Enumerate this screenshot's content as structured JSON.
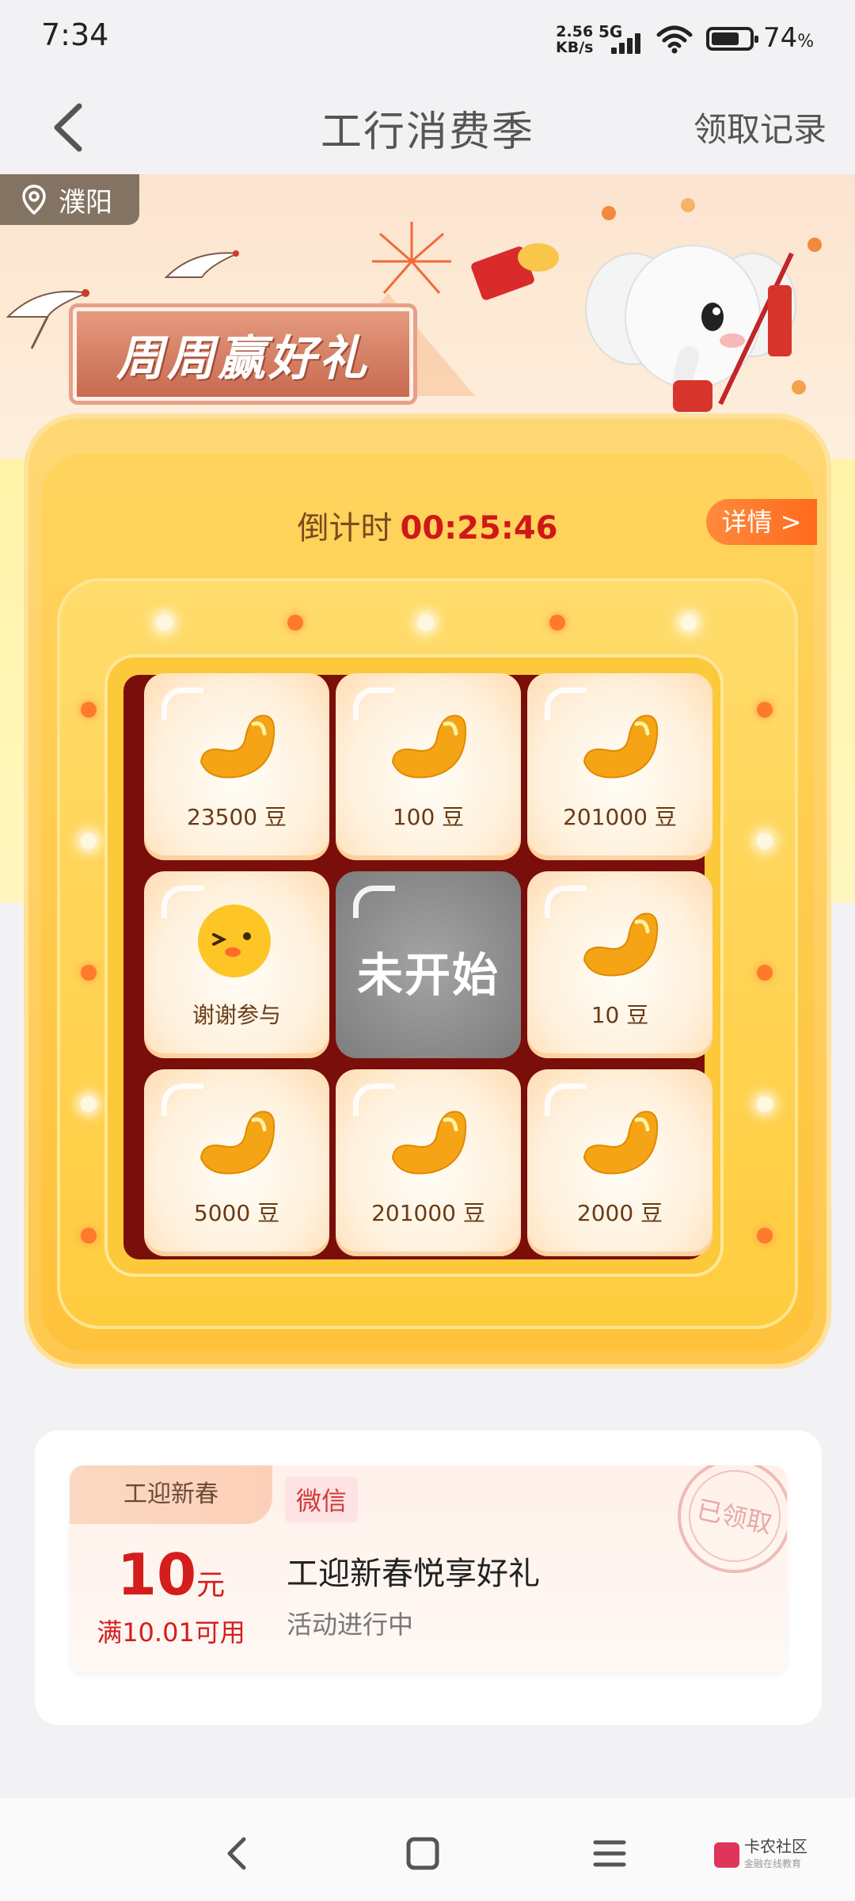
{
  "status_bar": {
    "time": "7:34",
    "speed_value": "2.56",
    "speed_unit": "KB/s",
    "network": "5G",
    "battery": "74",
    "battery_unit": "%"
  },
  "nav": {
    "title": "工行消费季",
    "record_link": "领取记录"
  },
  "banner": {
    "location": "濮阳",
    "headline": "周周赢好礼"
  },
  "lottery": {
    "countdown_label": "倒计时",
    "countdown_time": "00:25:46",
    "detail_button": "详情 >",
    "center_button": "未开始",
    "cells": [
      {
        "label": "23500 豆",
        "icon": "golden-bean-icon"
      },
      {
        "label": "100 豆",
        "icon": "golden-bean-icon"
      },
      {
        "label": "201000 豆",
        "icon": "golden-bean-icon"
      },
      {
        "label": "谢谢参与",
        "icon": "smiley-face-icon"
      },
      {
        "label": "10 豆",
        "icon": "golden-bean-icon"
      },
      {
        "label": "5000 豆",
        "icon": "golden-bean-icon"
      },
      {
        "label": "201000 豆",
        "icon": "golden-bean-icon"
      },
      {
        "label": "2000 豆",
        "icon": "golden-bean-icon"
      }
    ]
  },
  "coupon": {
    "tag": "工迎新春",
    "amount": "10",
    "amount_unit": "元",
    "condition": "满10.01可用",
    "channel": "微信",
    "title": "工迎新春悦享好礼",
    "status": "活动进行中",
    "stamp": "已领取"
  },
  "bottom_nav": {
    "brand_name": "卡农社区",
    "brand_sub": "金融在线教育"
  },
  "colors": {
    "accent_red": "#d01818",
    "card_yellow": "#ffc74e",
    "grid_dark_red": "#7a0e0a",
    "detail_orange": "#ff6a1c"
  }
}
